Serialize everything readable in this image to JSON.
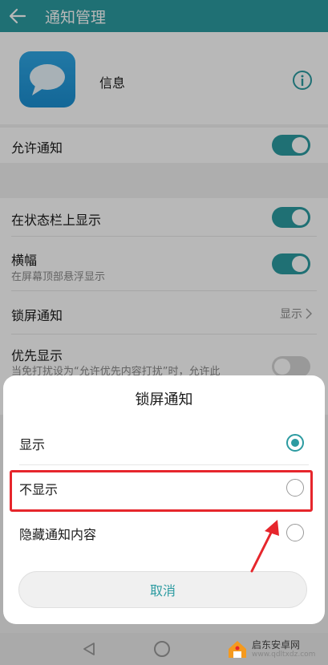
{
  "header": {
    "title": "通知管理",
    "back_icon": "back-arrow-icon"
  },
  "app": {
    "name": "信息",
    "icon": "message-bubble-icon",
    "info_icon": "info-icon"
  },
  "settings": {
    "allow_notifications": {
      "label": "允许通知",
      "enabled": true
    },
    "status_bar": {
      "label": "在状态栏上显示",
      "enabled": true
    },
    "banner": {
      "label": "横幅",
      "sub": "在屏幕顶部悬浮显示",
      "enabled": true
    },
    "lock_screen": {
      "label": "锁屏通知",
      "value": "显示"
    },
    "priority": {
      "label": "优先显示",
      "sub": "当免打扰设为“允许优先内容打扰”时，允许此",
      "enabled": false
    }
  },
  "dialog": {
    "title": "锁屏通知",
    "options": [
      {
        "label": "显示",
        "selected": true
      },
      {
        "label": "不显示",
        "selected": false
      },
      {
        "label": "隐藏通知内容",
        "selected": false
      }
    ],
    "cancel_label": "取消"
  },
  "watermark": {
    "title": "启东安卓网",
    "url": "www.qdltxdz.com"
  },
  "colors": {
    "accent": "#2c9ba1",
    "highlight": "#e6262c"
  }
}
